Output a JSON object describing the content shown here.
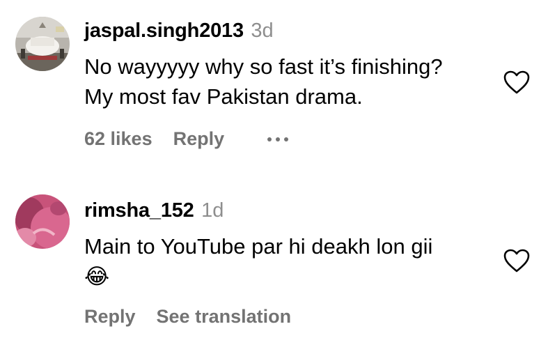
{
  "comments": [
    {
      "username": "jaspal.singh2013",
      "time": "3d",
      "text_lines": [
        "No wayyyyy why so fast it’s finishing?",
        "My most fav Pakistan drama."
      ],
      "likes": "62 likes",
      "reply": "Reply",
      "more_icon": "more-horizontal-icon",
      "heart_icon": "heart-outline-icon"
    },
    {
      "username": "rimsha_152",
      "time": "1d",
      "text_lines": [
        "Main to YouTube par hi deakh lon gii",
        "😂"
      ],
      "reply": "Reply",
      "see_translation": "See translation",
      "heart_icon": "heart-outline-icon"
    }
  ],
  "colors": {
    "primary_text": "#000000",
    "secondary_text": "#737373",
    "timestamp": "#8e8e8e"
  }
}
